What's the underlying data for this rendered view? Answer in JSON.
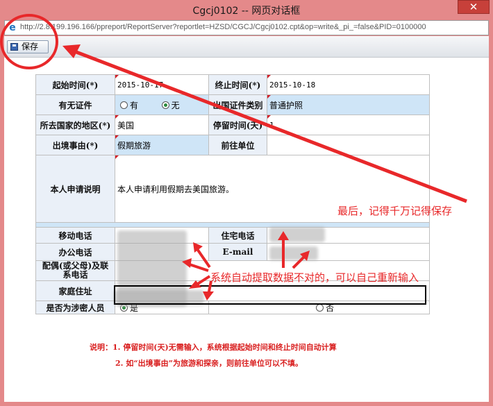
{
  "window": {
    "title": "Cgcj0102 -- 网页对话框",
    "close": "✕",
    "url": "http://2.8.199.196.166/ppreport/ReportServer?reportlet=HZSD/CGCJ/Cgcj0102.cpt&op=write&_pi_=false&PID=0100000"
  },
  "toolbar": {
    "save_label": "保存"
  },
  "form": {
    "start_time_label": "起始时间(*)",
    "start_time_value": "2015-10-17",
    "end_time_label": "终止时间(*)",
    "end_time_value": "2015-10-18",
    "has_cert_label": "有无证件",
    "has_cert_yes": "有",
    "has_cert_no": "无",
    "cert_type_label": "出国证件类别",
    "cert_type_value": "普通护照",
    "country_label": "所去国家的地区(*)",
    "country_value": "美国",
    "stay_label": "停留时间(天)",
    "stay_value": "1",
    "reason_label": "出境事由(*)",
    "reason_value": "假期旅游",
    "dest_unit_label": "前往单位",
    "statement_label": "本人申请说明",
    "statement_value": "本人申请利用假期去美国旅游。",
    "mobile_label": "移动电话",
    "home_phone_label": "住宅电话",
    "office_phone_label": "办公电话",
    "email_label": "E-mail",
    "spouse_label_1": "配偶(或父母)及联",
    "spouse_label_2": "系电话",
    "address_label": "家庭住址",
    "secret_label": "是否为涉密人员",
    "secret_yes": "是",
    "secret_no": "否"
  },
  "notes": {
    "line1": "说明：1. 停留时间(天)无需输入，系统根据起始时间和终止时间自动计算",
    "line2": "2.  如“出境事由”为旅游和探亲，则前往单位可以不填。"
  },
  "annotations": {
    "save_reminder": "最后，记得千万记得保存",
    "auto_fill": "系统自动提取数据不对的，可以自己重新输入"
  },
  "colors": {
    "annotation_red": "#e8282a",
    "label_bg": "#eaf0f8",
    "highlight_bg": "#cfe5f7",
    "title_bar": "#e4898a"
  }
}
